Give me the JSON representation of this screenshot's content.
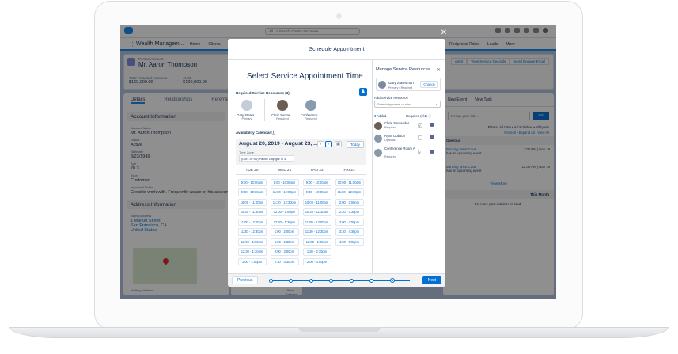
{
  "salesforce": {
    "search_placeholder": "Search Clients and more...",
    "search_scope": "All",
    "app_name": "Wealth Managem...",
    "nav": [
      "Home",
      "Clients"
    ],
    "nav_right": [
      "Reciprocal Roles",
      "Leads",
      "More"
    ],
    "account": {
      "type_label": "Person Account",
      "name": "Mr. Aaron Thompson",
      "fields": [
        {
          "label": "Total Financial Accounts",
          "value": "$160,000.00"
        },
        {
          "label": "AUM",
          "value": "$100,000.00"
        }
      ]
    },
    "header_buttons": [
      "ment",
      "View Service Records",
      "Send Engage Email"
    ],
    "tabs": [
      "Details",
      "Relationships",
      "Referrals"
    ],
    "account_info": {
      "section": "Account Information",
      "fields": [
        {
          "label": "Account Name",
          "value": "Mr. Aaron Thompson"
        },
        {
          "label": "Status",
          "value": "Active"
        },
        {
          "label": "Birthdate",
          "value": "3/23/1949"
        },
        {
          "label": "Age",
          "value": "70.3"
        },
        {
          "label": "Type",
          "value": "Customer"
        },
        {
          "label": "Important Notes",
          "value": "Great to work with. Frequently aware of his account values"
        }
      ]
    },
    "address_info": {
      "section": "Address Information",
      "billing_label": "Billing Address",
      "billing_lines": [
        "1 Market Street",
        "San Francisco, CA",
        "United States"
      ],
      "mailing_label": "Mailing Address",
      "other_label": "Other Address"
    },
    "activity": {
      "tabs": [
        "New Event",
        "New Task"
      ],
      "recap_placeholder": "Recap your call...",
      "add_label": "Add",
      "filters": "Filters: All time • All activities • All types",
      "links": "Refresh • Expand All • View All",
      "overdue_label": "Overdue",
      "items": [
        {
          "title": "Banking Wrist Court",
          "desc": "has an upcoming event",
          "time": "1:00 PM | Nov 19"
        },
        {
          "title": "Banking Wrist Court",
          "desc": "has an upcoming event",
          "time": "12:00 PM | Nov 19"
        }
      ],
      "view_more": "View More",
      "month_label": "This Month",
      "no_more": "No more past activities to load."
    }
  },
  "modal": {
    "title": "Schedule Appointment",
    "heading": "Select Service Appointment Time",
    "required_label": "Required Service Resources (3)",
    "resources": [
      {
        "name": "Gary States...",
        "role": "Primary"
      },
      {
        "name": "Chris Santan...",
        "role": "Required"
      },
      {
        "name": "Conference ...",
        "role": "Required"
      }
    ],
    "availability_label": "Availability Calendar",
    "date_range": "August 20, 2019 - August 23, ...",
    "today_label": "Today",
    "timezone_label": "Time Zone",
    "timezone_value": "(GMT-07:00) Pacific Daylight Ti",
    "days": [
      "TUE 20",
      "WED 21",
      "THU 22",
      "FRI 23"
    ],
    "slots": [
      [
        "9:00 - 10:00am",
        "9:30 - 10:30am",
        "10:00 - 11:00am",
        "10:30 - 11:30am",
        "11:00 - 12:00pm",
        "11:30 - 12:30pm",
        "12:00 - 1:00pm",
        "12:30 - 1:30pm",
        "1:00 - 2:00pm"
      ],
      [
        "9:00 - 10:00am",
        "11:00 - 12:00pm",
        "11:30 - 12:30pm",
        "12:00 - 1:00pm",
        "12:30 - 1:30pm",
        "1:00 - 2:00pm",
        "1:30 - 2:30pm",
        "2:00 - 3:00pm",
        "2:30 - 3:30pm"
      ],
      [
        "9:00 - 10:00am",
        "9:30 - 10:30am",
        "10:00 - 11:00am",
        "10:30 - 11:30am",
        "11:00 - 12:00pm",
        "11:30 - 12:30pm",
        "12:00 - 1:00pm",
        "1:30 - 2:30pm",
        "2:00 - 3:00pm"
      ],
      [
        "10:00 - 11:00am",
        "11:30 - 12:30pm",
        "2:00 - 3:00pm",
        "2:30 - 3:30pm",
        "3:00 - 4:00pm",
        "3:30 - 4:30pm",
        "4:00 - 5:00pm"
      ]
    ],
    "previous_label": "Previous",
    "next_label": "Next",
    "progress_steps": 7,
    "progress_current": 6,
    "manage": {
      "title": "Manage Service Resources",
      "primary_name": "Gary Statesman",
      "primary_sub": "Primary • Required",
      "change_label": "Change",
      "add_label": "Add Service Resource",
      "search_placeholder": "Search by name or role...",
      "added_count": "3 Added",
      "required_count": "Required (2/4)",
      "items": [
        {
          "name": "Chris Santander",
          "sub": "Required",
          "checked": true
        },
        {
          "name": "Ryan Dobson",
          "sub": "Optional",
          "checked": false
        },
        {
          "name": "Conference Room A",
          "sub": "Required",
          "checked": true
        }
      ]
    }
  }
}
